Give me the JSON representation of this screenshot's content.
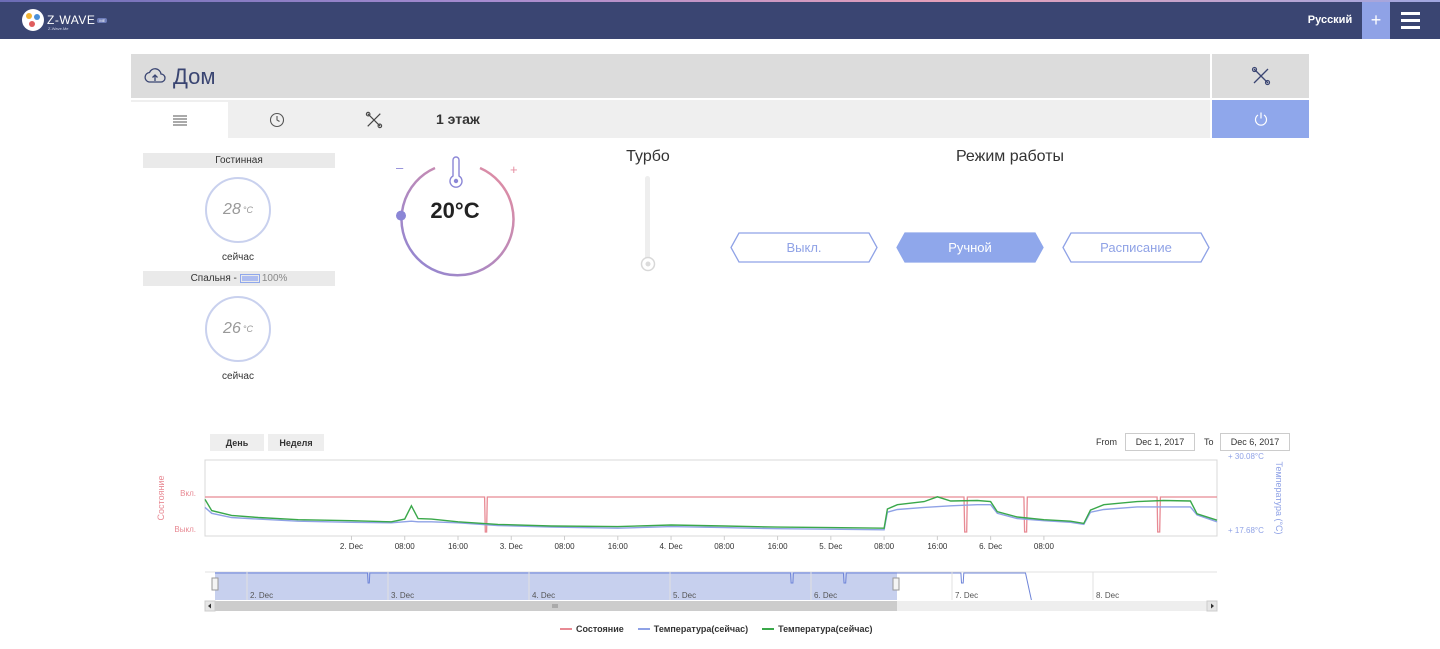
{
  "topbar": {
    "logo_text": "Z-WAVE",
    "logo_badge": "ME",
    "logo_sub": "Z-Wave.Me",
    "language": "Русский",
    "plus_label": "+"
  },
  "header": {
    "title": "Дом",
    "floor_title": "1 этаж"
  },
  "colors": {
    "accent": "#8fa7eb",
    "topbar": "#3a4572",
    "state_series": "#e88a94",
    "temp_blue": "#8fa2e6",
    "temp_green": "#3aa84a"
  },
  "rooms": [
    {
      "name": "Гостинная",
      "temp": "28",
      "unit": "°C",
      "now": "сейчас"
    },
    {
      "name": "Спальня -",
      "battery": "100%",
      "temp": "26",
      "unit": "°C",
      "now": "сейчас"
    }
  ],
  "thermostat": {
    "value": "20°C",
    "minus": "–",
    "plus": "+",
    "level": 0.15
  },
  "turbo": {
    "label": "Турбо",
    "level": 0
  },
  "mode": {
    "label": "Режим работы",
    "options": [
      "Выкл.",
      "Ручной",
      "Расписание"
    ],
    "selected": "Ручной"
  },
  "chart_controls": {
    "day_label": "День",
    "week_label": "Неделя",
    "from_label": "From",
    "from_value": "Dec 1, 2017",
    "to_label": "To",
    "to_value": "Dec 6, 2017"
  },
  "chart_data": {
    "type": "line",
    "x_tick_labels": [
      "2. Dec",
      "08:00",
      "16:00",
      "3. Dec",
      "08:00",
      "16:00",
      "4. Dec",
      "08:00",
      "16:00",
      "5. Dec",
      "08:00",
      "16:00",
      "6. Dec",
      "08:00"
    ],
    "navigator_tick_labels": [
      "2. Dec",
      "3. Dec",
      "4. Dec",
      "5. Dec",
      "6. Dec",
      "7. Dec",
      "8. Dec"
    ],
    "left_axis": {
      "label": "Состояние",
      "ticks": [
        "Вкл.",
        "Выкл."
      ]
    },
    "right_axis": {
      "label": "Температура (°C)",
      "max_label": "+ 30.08°C",
      "min_label": "+ 17.68°C",
      "range": [
        17.68,
        30.08
      ]
    },
    "x_range_hours": [
      -22,
      130
    ],
    "series": [
      {
        "name": "Состояние",
        "color": "#e88a94",
        "points": [
          [
            -22,
            1
          ],
          [
            20,
            1
          ],
          [
            20.1,
            0
          ],
          [
            20.3,
            0
          ],
          [
            20.4,
            1
          ],
          [
            92,
            1
          ],
          [
            92.1,
            0
          ],
          [
            92.4,
            0
          ],
          [
            92.5,
            1
          ],
          [
            101,
            1
          ],
          [
            101.1,
            0
          ],
          [
            101.4,
            0
          ],
          [
            101.5,
            1
          ],
          [
            121,
            1
          ],
          [
            121.1,
            0
          ],
          [
            121.4,
            0
          ],
          [
            121.5,
            1
          ],
          [
            130,
            1
          ]
        ]
      },
      {
        "name": "Температура(сейчас)",
        "color": "#8fa2e6",
        "points": [
          [
            -22,
            22.3
          ],
          [
            -21,
            21.2
          ],
          [
            -18,
            20.4
          ],
          [
            -14,
            20.1
          ],
          [
            -8,
            19.7
          ],
          [
            0,
            19.5
          ],
          [
            6,
            19.4
          ],
          [
            9,
            19.7
          ],
          [
            10,
            19.6
          ],
          [
            12,
            19.6
          ],
          [
            16,
            19.4
          ],
          [
            22,
            18.9
          ],
          [
            30,
            18.6
          ],
          [
            40,
            18.4
          ],
          [
            48,
            18.7
          ],
          [
            56,
            18.5
          ],
          [
            64,
            18.3
          ],
          [
            72,
            18.2
          ],
          [
            80,
            18.1
          ],
          [
            80.5,
            21.4
          ],
          [
            82,
            21.9
          ],
          [
            86,
            22.3
          ],
          [
            90,
            22.6
          ],
          [
            94,
            22.8
          ],
          [
            96,
            22.8
          ],
          [
            97,
            21.2
          ],
          [
            100,
            20.2
          ],
          [
            104,
            19.8
          ],
          [
            108,
            19.5
          ],
          [
            110,
            19.1
          ],
          [
            111,
            21.4
          ],
          [
            113,
            21.9
          ],
          [
            118,
            22.4
          ],
          [
            122,
            22.4
          ],
          [
            126,
            22.4
          ],
          [
            127,
            20.9
          ],
          [
            130,
            19.6
          ],
          [
            134,
            19.3
          ],
          [
            142,
            18.7
          ],
          [
            150,
            18.5
          ],
          [
            155,
            18.2
          ],
          [
            156,
            20.0
          ],
          [
            158,
            21.2
          ],
          [
            160,
            21.2
          ]
        ]
      },
      {
        "name": "Температура(сейчас)",
        "color": "#3aa84a",
        "points": [
          [
            -22,
            23.8
          ],
          [
            -21,
            21.7
          ],
          [
            -18,
            20.8
          ],
          [
            -14,
            20.4
          ],
          [
            -8,
            20.0
          ],
          [
            0,
            19.8
          ],
          [
            6,
            19.6
          ],
          [
            8,
            20.1
          ],
          [
            9,
            22.6
          ],
          [
            10,
            20.2
          ],
          [
            12,
            20.1
          ],
          [
            16,
            19.6
          ],
          [
            22,
            19.1
          ],
          [
            30,
            18.8
          ],
          [
            40,
            18.7
          ],
          [
            48,
            19.0
          ],
          [
            56,
            18.8
          ],
          [
            64,
            18.6
          ],
          [
            72,
            18.5
          ],
          [
            80,
            18.4
          ],
          [
            80.5,
            22.0
          ],
          [
            82,
            22.8
          ],
          [
            86,
            23.4
          ],
          [
            88,
            24.3
          ],
          [
            90,
            23.5
          ],
          [
            94,
            23.6
          ],
          [
            96,
            23.4
          ],
          [
            97,
            21.5
          ],
          [
            100,
            20.5
          ],
          [
            104,
            20.0
          ],
          [
            108,
            19.7
          ],
          [
            110,
            19.3
          ],
          [
            111,
            21.8
          ],
          [
            113,
            22.8
          ],
          [
            118,
            23.4
          ],
          [
            122,
            23.6
          ],
          [
            126,
            23.5
          ],
          [
            127,
            21.1
          ],
          [
            130,
            19.9
          ],
          [
            134,
            19.5
          ],
          [
            142,
            18.9
          ],
          [
            150,
            18.7
          ],
          [
            155,
            18.4
          ],
          [
            156,
            20.5
          ],
          [
            158,
            22.4
          ],
          [
            160,
            22.4
          ]
        ]
      }
    ],
    "legend": [
      "Состояние",
      "Температура(сейчас)",
      "Температура(сейчас)"
    ],
    "legend_placement": "bottom-center",
    "grid": false
  }
}
